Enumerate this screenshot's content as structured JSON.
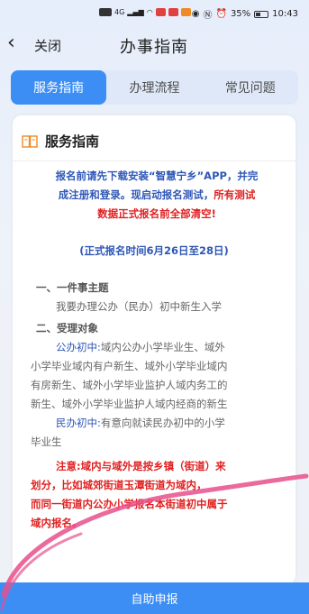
{
  "status_bar": {
    "network": "4G",
    "battery": "35%",
    "time": "10:43"
  },
  "header": {
    "close_label": "关闭",
    "title": "办事指南"
  },
  "tabs": [
    {
      "label": "服务指南",
      "active": true
    },
    {
      "label": "办理流程",
      "active": false
    },
    {
      "label": "常见问题",
      "active": false
    }
  ],
  "card": {
    "title": "服务指南",
    "notice": {
      "line1": "报名前请先下载安装“智慧宁乡”APP，并完",
      "line2a": "成注册和登录。现启动报名测试，",
      "line2b": "所有测试",
      "line3": "数据正式报名前全部清空!",
      "time": "(正式报名时间6月26日至28日)"
    },
    "section1": {
      "heading": "一、一件事主题",
      "text": "我要办理公办（民办）初中新生入学"
    },
    "section2": {
      "heading": "二、受理对象",
      "public_label": "公办初中:",
      "public_text_1": "域内公办小学毕业生、域外",
      "public_text_2": "小学毕业域内有户新生、域外小学毕业域内",
      "public_text_3": "有房新生、域外小学毕业监护人域内务工的",
      "public_text_4": "新生、域外小学毕业监护人域内经商的新生",
      "private_label": "民办初中:",
      "private_text_1": "有意向就读民办初中的小学",
      "private_text_2": "毕业生",
      "note_label": "注意:",
      "note_text_1": "域内与域外是按乡镇（街道）来",
      "note_text_2": "划分，比如城郊街道玉潭街道为域内，",
      "note_text_3": "而同一街道内公办小学报名本街道初中属于",
      "note_text_4": "域内报名。"
    }
  },
  "bottom_button": "自助申报",
  "colors": {
    "accent": "#3c8ef5",
    "notice_blue": "#2f57b6",
    "warning_red": "#e02020",
    "pen_pink": "#e8508c"
  }
}
